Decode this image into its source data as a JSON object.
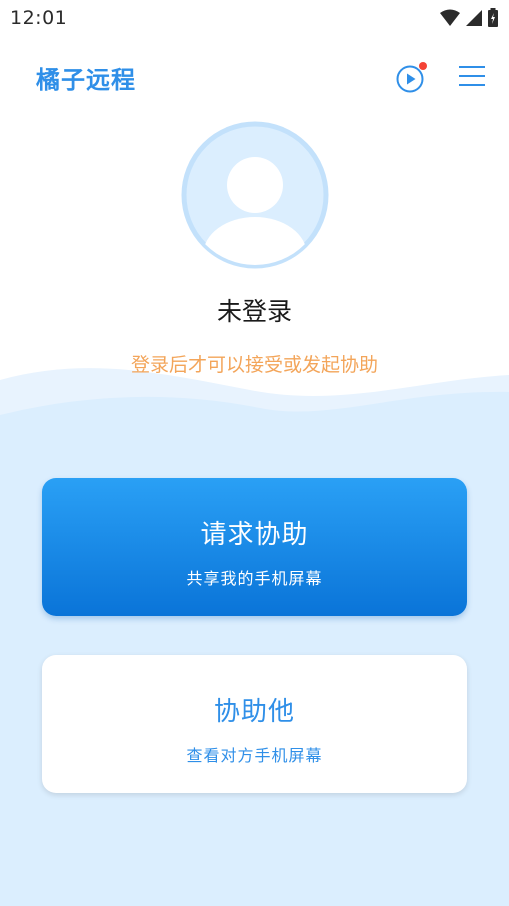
{
  "status_bar": {
    "time": "12:01",
    "icons": [
      "wifi-icon",
      "cellular-signal-icon",
      "battery-icon"
    ]
  },
  "app_bar": {
    "title": "橘子远程",
    "play_icon": "play-circle-icon",
    "menu_icon": "menu-icon",
    "has_notification_dot": true
  },
  "profile": {
    "avatar_icon": "user-avatar-icon",
    "status": "未登录",
    "hint": "登录后才可以接受或发起协助"
  },
  "actions": {
    "request_help": {
      "title": "请求协助",
      "subtitle": "共享我的手机屏幕"
    },
    "help_others": {
      "title": "协助他",
      "subtitle": "查看对方手机屏幕"
    }
  },
  "colors": {
    "brand_blue": "#2f8fe8",
    "hint_orange": "#f3a55a",
    "primary_gradient_top": "#2aa0f5",
    "primary_gradient_bottom": "#0a74d8",
    "light_blue_bg": "#dbeefe",
    "notification_red": "#f44336"
  }
}
